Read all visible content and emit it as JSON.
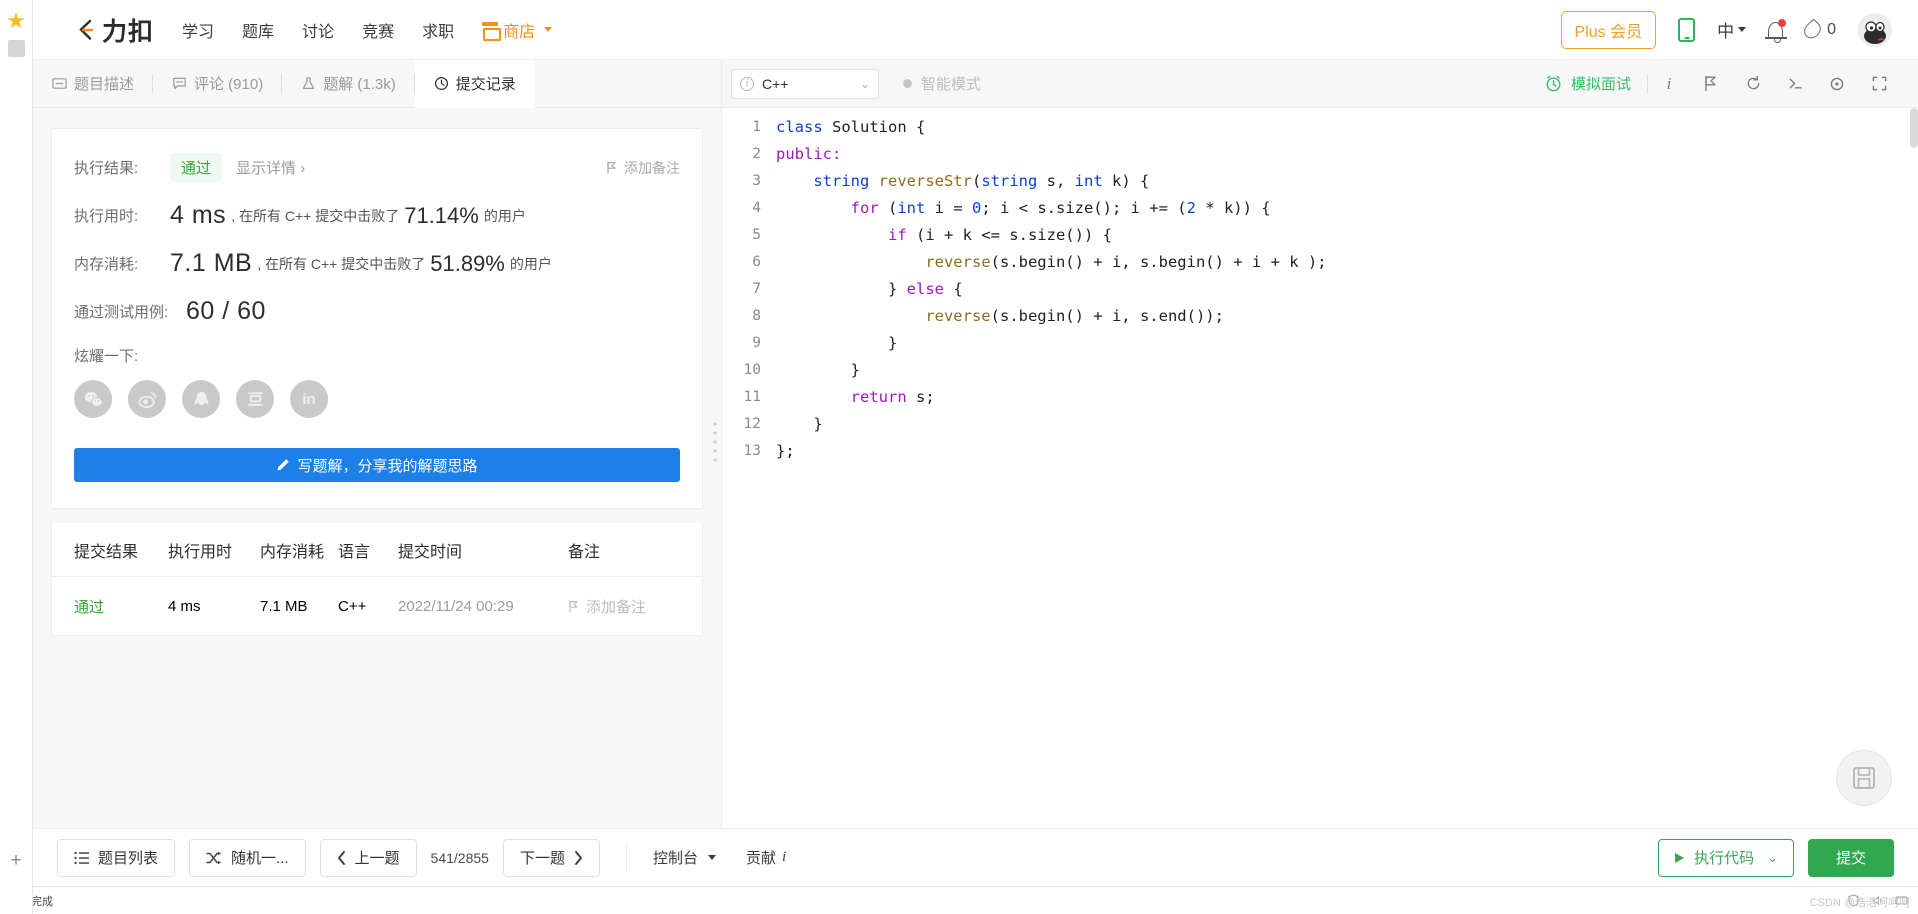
{
  "header": {
    "logo_text": "力扣",
    "nav": [
      {
        "label": "学习",
        "name": "nav-study"
      },
      {
        "label": "题库",
        "name": "nav-problems"
      },
      {
        "label": "讨论",
        "name": "nav-discuss"
      },
      {
        "label": "竞赛",
        "name": "nav-contest"
      },
      {
        "label": "求职",
        "name": "nav-jobs"
      }
    ],
    "shop_label": "商店",
    "plus_label": "Plus 会员",
    "lang_label": "中",
    "coin_count": "0"
  },
  "tabs": [
    {
      "label": "题目描述",
      "icon": "description-icon",
      "active": false
    },
    {
      "label": "评论 (910)",
      "icon": "comment-icon",
      "active": false
    },
    {
      "label": "题解 (1.3k)",
      "icon": "flask-icon",
      "active": false
    },
    {
      "label": "提交记录",
      "icon": "clock-icon",
      "active": true
    }
  ],
  "editor_bar": {
    "language": "C++",
    "smart_mode": "智能模式",
    "mock_interview": "模拟面试"
  },
  "result": {
    "result_label": "执行结果:",
    "status": "通过",
    "show_detail": "显示详情",
    "add_note": "添加备注",
    "runtime_label": "执行用时:",
    "runtime_value": "4 ms",
    "runtime_mid": ", 在所有 C++ 提交中击败了",
    "runtime_pct": "71.14%",
    "runtime_suffix": "的用户",
    "memory_label": "内存消耗:",
    "memory_value": "7.1 MB",
    "memory_mid": ", 在所有 C++ 提交中击败了",
    "memory_pct": "51.89%",
    "memory_suffix": "的用户",
    "cases_label": "通过测试用例:",
    "cases_value": "60 / 60",
    "showoff_label": "炫耀一下:",
    "socials": [
      {
        "name": "wechat-share-icon",
        "glyph": "wechat"
      },
      {
        "name": "weibo-share-icon",
        "glyph": "weibo"
      },
      {
        "name": "qq-share-icon",
        "glyph": "qq"
      },
      {
        "name": "douban-share-icon",
        "glyph": "douban"
      },
      {
        "name": "linkedin-share-icon",
        "glyph": "in"
      }
    ],
    "write_solution": "写题解，分享我的解题思路"
  },
  "table": {
    "headers": [
      "提交结果",
      "执行用时",
      "内存消耗",
      "语言",
      "提交时间",
      "备注"
    ],
    "rows": [
      {
        "status": "通过",
        "runtime": "4 ms",
        "memory": "7.1 MB",
        "language": "C++",
        "time": "2022/11/24 00:29",
        "note": "添加备注"
      }
    ]
  },
  "code": {
    "lines": [
      {
        "n": "1",
        "tokens": [
          {
            "t": "class ",
            "c": "k-type"
          },
          {
            "t": "Solution ",
            "c": "k-id"
          },
          {
            "t": "{",
            "c": "k-id"
          }
        ]
      },
      {
        "n": "2",
        "tokens": [
          {
            "t": "public:",
            "c": "k-kw"
          }
        ]
      },
      {
        "n": "3",
        "tokens": [
          {
            "t": "    ",
            "c": "k-id"
          },
          {
            "t": "string ",
            "c": "k-type"
          },
          {
            "t": "reverseStr",
            "c": "k-fn"
          },
          {
            "t": "(",
            "c": "k-id"
          },
          {
            "t": "string ",
            "c": "k-type"
          },
          {
            "t": "s, ",
            "c": "k-id"
          },
          {
            "t": "int ",
            "c": "k-type"
          },
          {
            "t": "k) {",
            "c": "k-id"
          }
        ]
      },
      {
        "n": "4",
        "tokens": [
          {
            "t": "        ",
            "c": "k-id"
          },
          {
            "t": "for ",
            "c": "k-kw"
          },
          {
            "t": "(",
            "c": "k-id"
          },
          {
            "t": "int ",
            "c": "k-type"
          },
          {
            "t": "i = ",
            "c": "k-id"
          },
          {
            "t": "0",
            "c": "k-num"
          },
          {
            "t": "; i < s.size(); i += (",
            "c": "k-id"
          },
          {
            "t": "2",
            "c": "k-num"
          },
          {
            "t": " * k)) {",
            "c": "k-id"
          }
        ]
      },
      {
        "n": "5",
        "tokens": [
          {
            "t": "            ",
            "c": "k-id"
          },
          {
            "t": "if ",
            "c": "k-kw"
          },
          {
            "t": "(i + k <= s.size()) {",
            "c": "k-id"
          }
        ]
      },
      {
        "n": "6",
        "tokens": [
          {
            "t": "                ",
            "c": "k-id"
          },
          {
            "t": "reverse",
            "c": "k-fn"
          },
          {
            "t": "(s.begin() + i, s.begin() + i + k );",
            "c": "k-id"
          }
        ]
      },
      {
        "n": "7",
        "tokens": [
          {
            "t": "            } ",
            "c": "k-id"
          },
          {
            "t": "else ",
            "c": "k-kw"
          },
          {
            "t": "{",
            "c": "k-id"
          }
        ]
      },
      {
        "n": "8",
        "tokens": [
          {
            "t": "                ",
            "c": "k-id"
          },
          {
            "t": "reverse",
            "c": "k-fn"
          },
          {
            "t": "(s.begin() + i, s.end());",
            "c": "k-id"
          }
        ]
      },
      {
        "n": "9",
        "tokens": [
          {
            "t": "            }",
            "c": "k-id"
          }
        ]
      },
      {
        "n": "10",
        "tokens": [
          {
            "t": "        }",
            "c": "k-id"
          }
        ]
      },
      {
        "n": "11",
        "tokens": [
          {
            "t": "        ",
            "c": "k-id"
          },
          {
            "t": "return ",
            "c": "k-kw"
          },
          {
            "t": "s;",
            "c": "k-id"
          }
        ]
      },
      {
        "n": "12",
        "tokens": [
          {
            "t": "    }",
            "c": "k-id"
          }
        ]
      },
      {
        "n": "13",
        "tokens": [
          {
            "t": "};",
            "c": "k-id"
          }
        ]
      }
    ]
  },
  "bottom": {
    "problem_list": "题目列表",
    "random": "随机一...",
    "prev": "上一题",
    "page": "541/2855",
    "next": "下一题",
    "console": "控制台",
    "contribute": "贡献",
    "run_code": "执行代码",
    "submit": "提交"
  },
  "statusbar": {
    "text": "完成",
    "watermark": "CSDN @浩浩呵呵呵"
  },
  "colors": {
    "accent_orange": "#f0a029",
    "accent_green": "#2fa84f",
    "accent_blue": "#1d7fe8",
    "pass_green": "#3aa63a"
  }
}
